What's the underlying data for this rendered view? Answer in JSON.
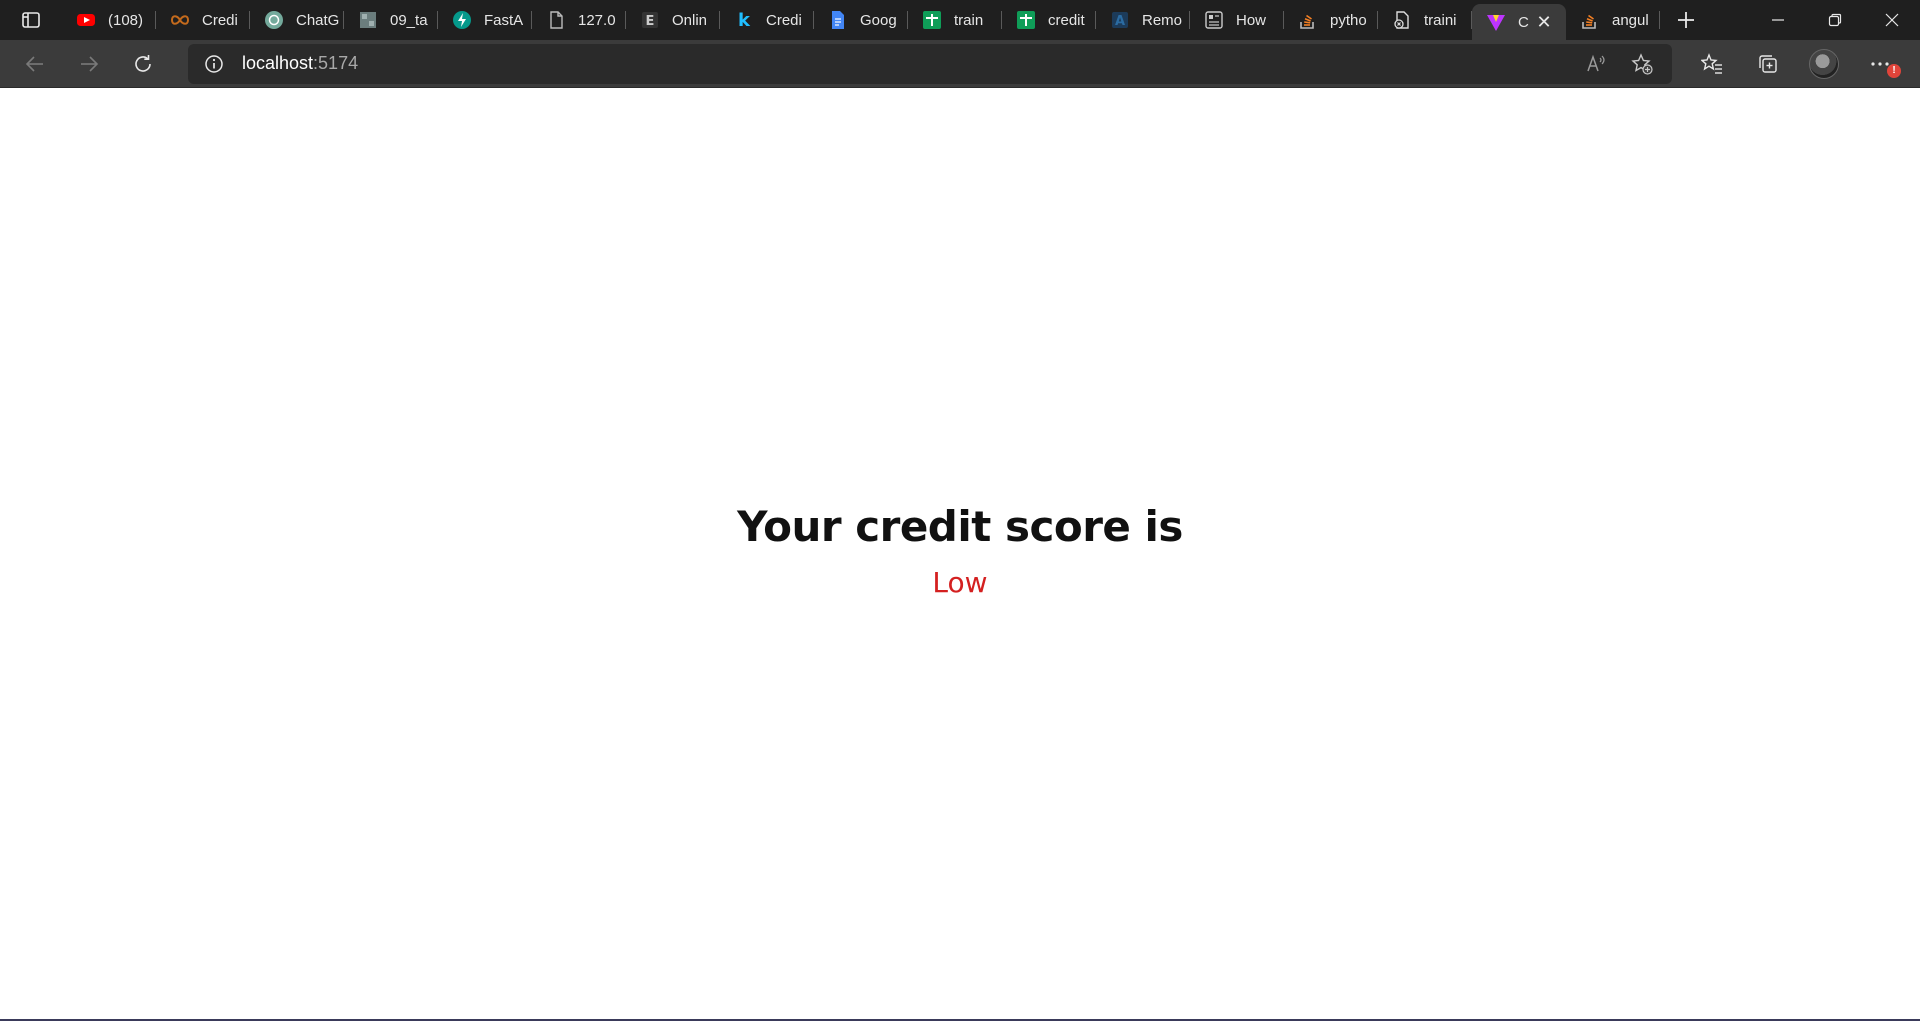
{
  "browser": {
    "tabs": [
      {
        "title": "(108)",
        "icon": "youtube-icon",
        "color": "#ff0000"
      },
      {
        "title": "Credi",
        "icon": "infinity-icon",
        "color": "#c46a1c"
      },
      {
        "title": "ChatG",
        "icon": "chatgpt-icon",
        "color": "#74aa9c"
      },
      {
        "title": "09_ta",
        "icon": "image-icon",
        "color": "#6b7d7d"
      },
      {
        "title": "FastA",
        "icon": "fastapi-icon",
        "color": "#05998b"
      },
      {
        "title": "127.0",
        "icon": "page-icon",
        "color": "#bbbbbb"
      },
      {
        "title": "Onlin",
        "icon": "e-letter-icon",
        "color": "#cccccc"
      },
      {
        "title": "Credi",
        "icon": "kaggle-icon",
        "color": "#20beff"
      },
      {
        "title": "Goog",
        "icon": "docs-icon",
        "color": "#4285f4"
      },
      {
        "title": "train",
        "icon": "sheets-icon",
        "color": "#0f9d58"
      },
      {
        "title": "credit",
        "icon": "sheets-icon",
        "color": "#0f9d58"
      },
      {
        "title": "Remo",
        "icon": "a-letter-icon",
        "color": "#2b6ca3"
      },
      {
        "title": "How",
        "icon": "article-icon",
        "color": "#cccccc"
      },
      {
        "title": "pytho",
        "icon": "stackoverflow-icon",
        "color": "#f48024"
      },
      {
        "title": "traini",
        "icon": "file-error-icon",
        "color": "#dddddd"
      },
      {
        "title": "C",
        "icon": "vite-icon",
        "color": "#bd34fe",
        "active": true
      },
      {
        "title": "angul",
        "icon": "stackoverflow-icon",
        "color": "#f48024"
      }
    ],
    "address": {
      "host": "localhost",
      "port": ":5174"
    }
  },
  "page": {
    "heading": "Your credit score is",
    "score": "Low",
    "score_color": "#d42020"
  }
}
